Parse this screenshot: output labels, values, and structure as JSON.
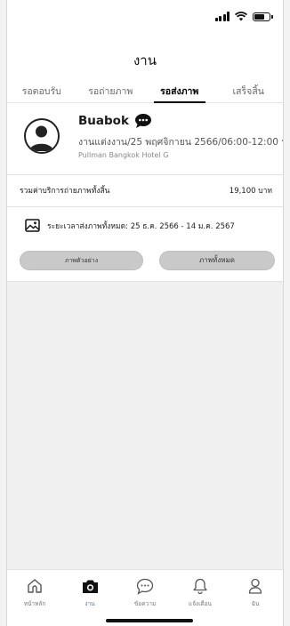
{
  "header": {
    "title": "งาน"
  },
  "tabs": [
    {
      "label": "รอตอบรับ",
      "active": false
    },
    {
      "label": "รอถ่ายภาพ",
      "active": false
    },
    {
      "label": "รอส่งภาพ",
      "active": true
    },
    {
      "label": "เสร็จสิ้น",
      "active": false
    }
  ],
  "booking": {
    "customer_name": "Buabok",
    "event_line": "งานแต่งงาน/25 พฤศจิกายน 2566/06:00-12:00 น",
    "venue": "Pullman Bangkok Hotel G",
    "total_label": "รวมค่าบริการถ่ายภาพทั้งสิ้น",
    "total_value": "19,100 บาท",
    "delivery_range": "ระยะเวลาส่งภาพทั้งหมด: 25 ธ.ค. 2566 - 14 ม.ค. 2567",
    "sample_button": "ภาพตัวอย่าง",
    "all_photos_button": "ภาพทั้งหมด"
  },
  "bottom_nav": [
    {
      "label": "หน้าหลัก",
      "icon": "home-icon",
      "active": false
    },
    {
      "label": "งาน",
      "icon": "camera-icon",
      "active": true
    },
    {
      "label": "ข้อความ",
      "icon": "chat-icon",
      "active": false
    },
    {
      "label": "แจ้งเตือน",
      "icon": "bell-icon",
      "active": false
    },
    {
      "label": "ฉัน",
      "icon": "user-icon",
      "active": false
    }
  ],
  "colors": {
    "accent": "#3d7be8",
    "button_bg": "#c9c9c9",
    "background": "#f0f0f0"
  }
}
